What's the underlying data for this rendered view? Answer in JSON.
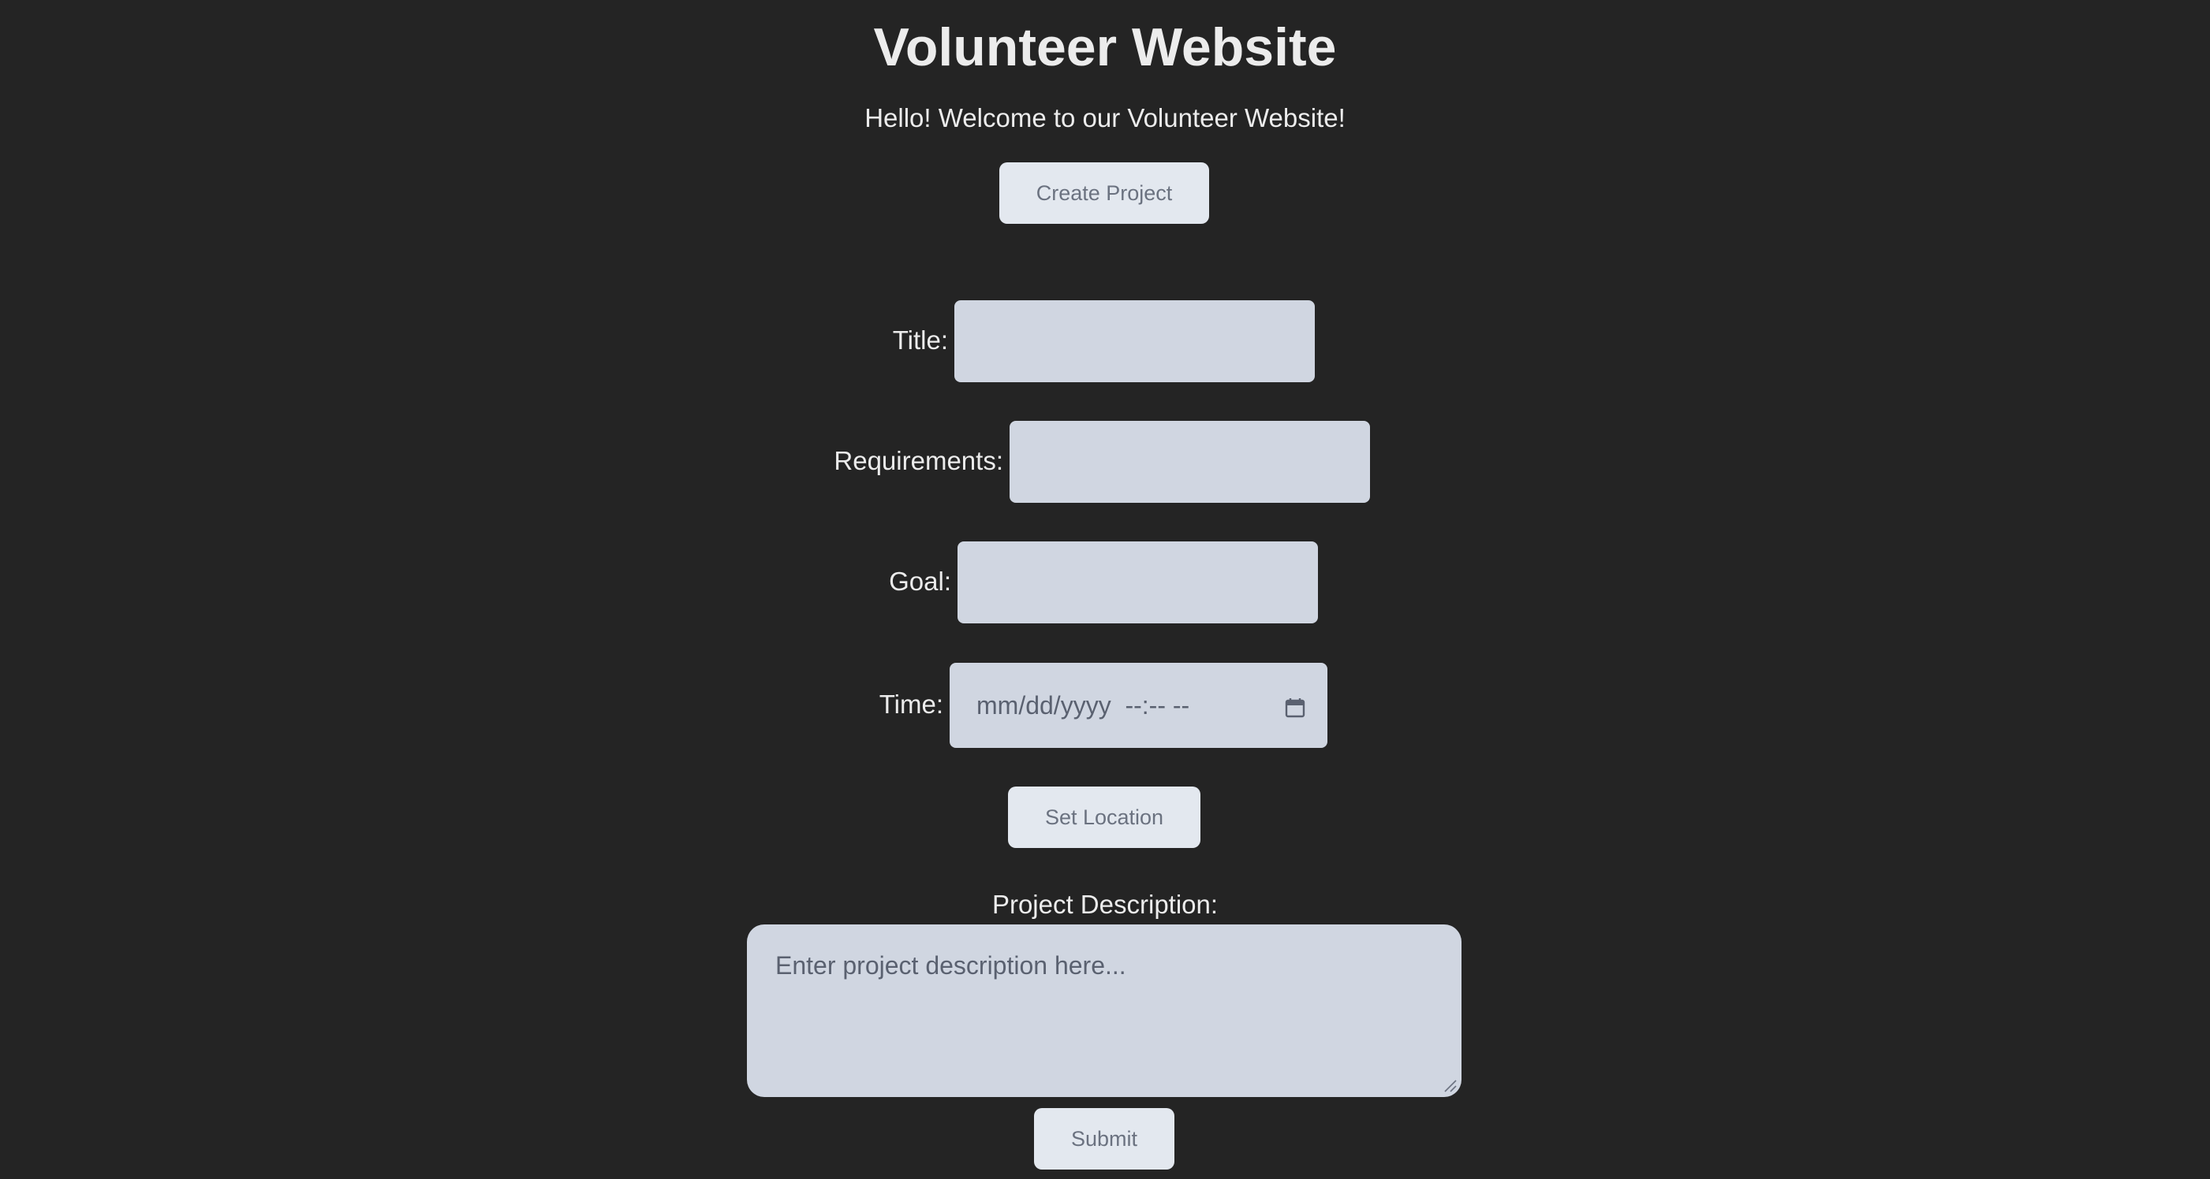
{
  "header": {
    "title": "Volunteer Website",
    "welcome": "Hello! Welcome to our Volunteer Website!"
  },
  "actions": {
    "create_project_label": "Create Project",
    "set_location_label": "Set Location",
    "submit_label": "Submit"
  },
  "form": {
    "title_label": "Title:",
    "title_value": "",
    "requirements_label": "Requirements:",
    "requirements_value": "",
    "goal_label": "Goal:",
    "goal_value": "",
    "time_label": "Time:",
    "time_placeholder": "mm/dd/yyyy  --:-- --",
    "description_label": "Project Description:",
    "description_placeholder": "Enter project description here..."
  },
  "icons": {
    "calendar": "calendar-icon",
    "resize": "resize-handle-icon"
  },
  "colors": {
    "background": "#242424",
    "input_bg": "#d0d6e1",
    "button_bg": "#e3e8ef",
    "button_text": "#6b7280",
    "text": "#ececec"
  }
}
